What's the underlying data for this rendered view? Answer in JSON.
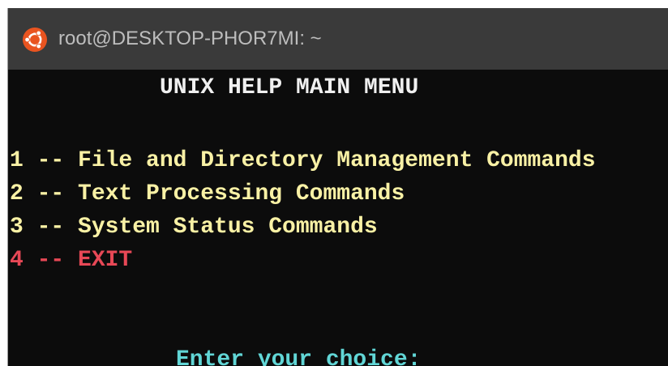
{
  "window": {
    "title": "root@DESKTOP-PHOR7MI: ~",
    "icon": "ubuntu-logo-icon"
  },
  "terminal": {
    "heading": "UNIX HELP MAIN MENU",
    "menu": [
      {
        "label": "1 -- File and Directory Management Commands",
        "color": "#f9f1a5"
      },
      {
        "label": "2 -- Text Processing Commands",
        "color": "#f9f1a5"
      },
      {
        "label": "3 -- System Status Commands",
        "color": "#f9f1a5"
      },
      {
        "label": "4 -- EXIT",
        "color": "#e74856"
      }
    ],
    "prompt": "Enter your choice:"
  },
  "colors": {
    "background": "#0c0c0c",
    "titlebar": "#3a3a3a",
    "ubuntu_orange": "#e95420",
    "heading_text": "#f0f0f0",
    "prompt_text": "#61d6d6"
  }
}
